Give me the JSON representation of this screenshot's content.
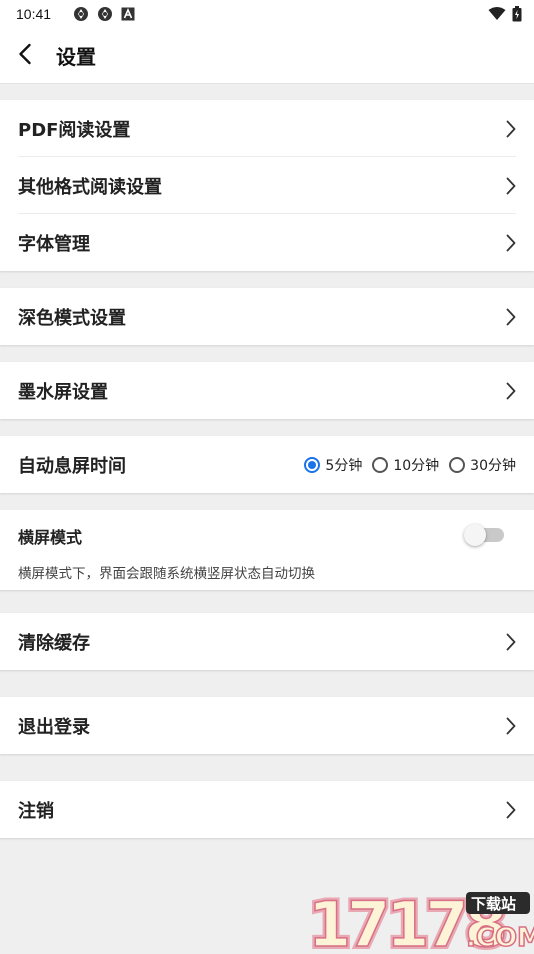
{
  "status_bar": {
    "time": "10:41",
    "icons": [
      "sync-icon",
      "sync-icon",
      "text-a-icon",
      "wifi-icon",
      "battery-icon"
    ]
  },
  "header": {
    "title": "设置",
    "back_icon": "back-arrow-icon"
  },
  "groups": {
    "reading": [
      {
        "label": "PDF阅读设置"
      },
      {
        "label": "其他格式阅读设置"
      },
      {
        "label": "字体管理"
      }
    ],
    "dark_mode": {
      "label": "深色模式设置"
    },
    "eink": {
      "label": "墨水屏设置"
    },
    "screen_off": {
      "label": "自动息屏时间",
      "options": [
        "5分钟",
        "10分钟",
        "30分钟"
      ],
      "selected": "5分钟"
    },
    "landscape": {
      "title": "横屏模式",
      "description": "横屏模式下，界面会跟随系统横竖屏状态自动切换",
      "enabled": false
    },
    "clear_cache": {
      "label": "清除缓存"
    },
    "logout": {
      "label": "退出登录"
    },
    "cancel_account": {
      "label": "注销"
    }
  },
  "watermark": {
    "text": "17178",
    "badge": "下载站",
    "suffix": ".COM"
  },
  "colors": {
    "accent": "#1a73e8",
    "background": "#efefef",
    "surface": "#ffffff"
  }
}
